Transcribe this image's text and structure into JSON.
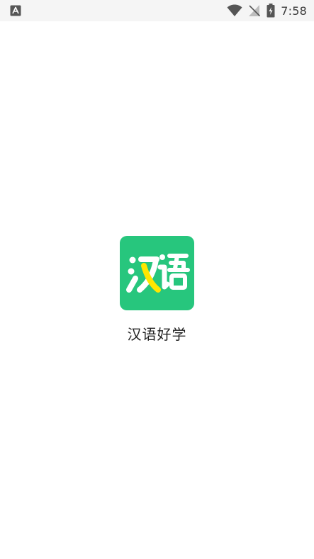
{
  "status_bar": {
    "time": "7:58",
    "left_icon": "a-notification-icon",
    "wifi_icon": "wifi-icon",
    "signal_icon": "no-signal-icon",
    "battery_icon": "battery-charging-icon"
  },
  "splash": {
    "icon_text": "汉语",
    "app_name": "汉语好学",
    "icon_color": "#27c67d",
    "accent_color": "#ffe600"
  }
}
